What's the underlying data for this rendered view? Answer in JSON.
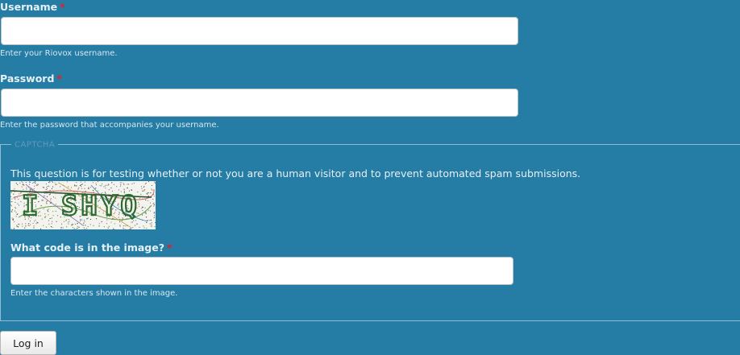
{
  "username": {
    "label": "Username",
    "required_mark": "*",
    "value": "",
    "description": "Enter your Riovox username."
  },
  "password": {
    "label": "Password",
    "required_mark": "*",
    "value": "",
    "description": "Enter the password that accompanies your username."
  },
  "captcha": {
    "legend": "CAPTCHA",
    "description": "This question is for testing whether or not you are a human visitor and to prevent automated spam submissions.",
    "image_text": "I SHYQ",
    "code_label": "What code is in the image?",
    "required_mark": "*",
    "code_value": "",
    "code_description": "Enter the characters shown in the image."
  },
  "actions": {
    "login_label": "Log in"
  },
  "colors": {
    "page_background": "#257ca4",
    "required": "#e0212b"
  }
}
